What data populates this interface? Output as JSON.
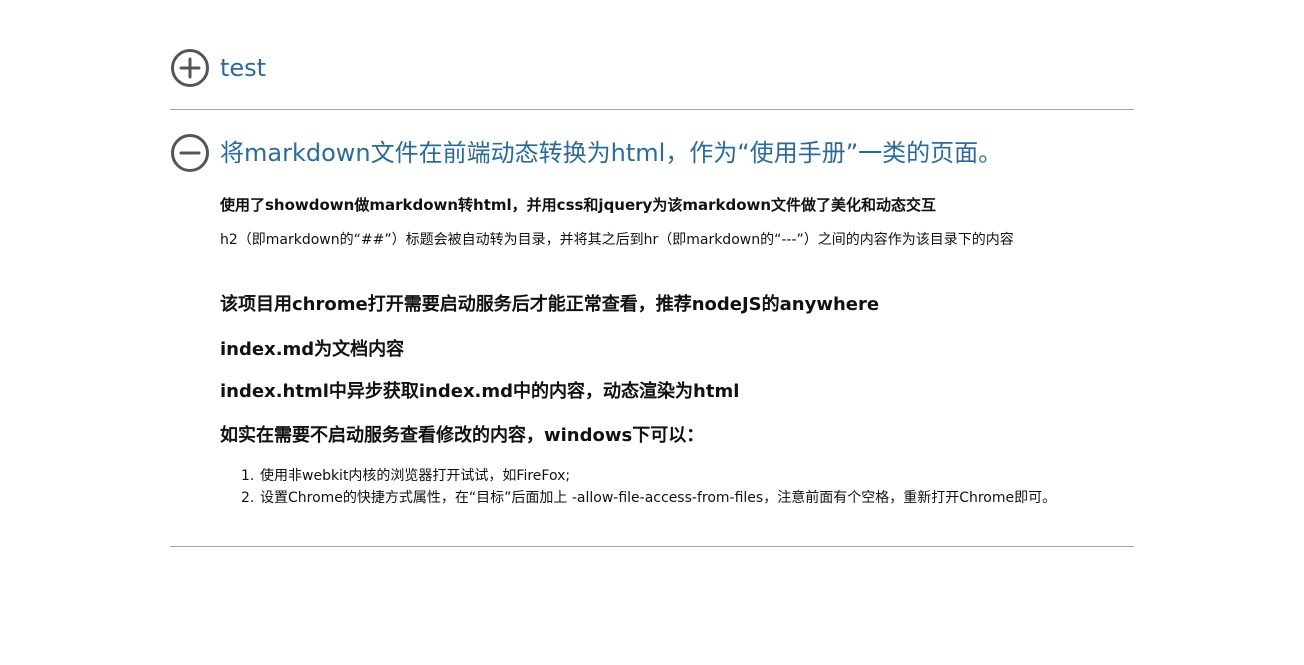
{
  "sections": [
    {
      "title": "test",
      "toggle_icon": "plus-circle-icon"
    },
    {
      "title": "将markdown文件在前端动态转换为html，作为“使用手册”一类的页面。",
      "toggle_icon": "minus-circle-icon",
      "lead": "使用了showdown做markdown转html，并用css和jquery为该markdown文件做了美化和动态交互",
      "para": "h2（即markdown的“##”）标题会被自动转为目录，并将其之后到hr（即markdown的“---”）之间的内容作为该目录下的内容",
      "headings": [
        "该项目用chrome打开需要启动服务后才能正常查看，推荐nodeJS的anywhere",
        "index.md为文档内容",
        "index.html中异步获取index.md中的内容，动态渲染为html",
        "如实在需要不启动服务查看修改的内容，windows下可以："
      ],
      "steps": [
        {
          "num": "1.",
          "text": "使用非webkit内核的浏览器打开试试，如FireFox;"
        },
        {
          "num": "2.",
          "text": "设置Chrome的快捷方式属性，在“目标”后面加上 -allow-file-access-from-files，注意前面有个空格，重新打开Chrome即可。"
        }
      ]
    }
  ],
  "colors": {
    "title": "#2c6a9a",
    "icon": "#555555",
    "divider": "#a7a7a7",
    "text": "#111111"
  }
}
